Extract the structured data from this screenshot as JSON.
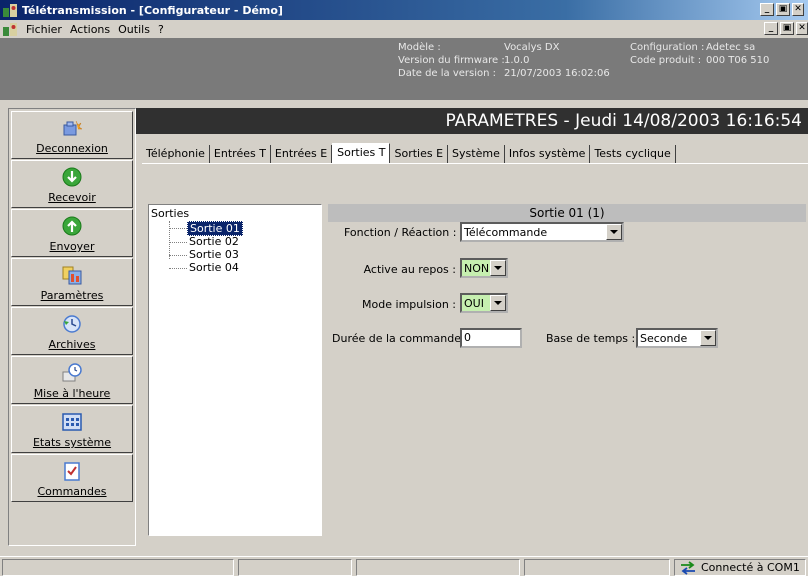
{
  "window": {
    "title": "Télétransmission - [Configurateur - Démo]",
    "controls": {
      "minimize": "_",
      "maximize": "🗗",
      "close": "✕"
    }
  },
  "menu": {
    "items": [
      "Fichier",
      "Actions",
      "Outils",
      "?"
    ]
  },
  "info": {
    "model_label": "Modèle :",
    "model_value": "Vocalys DX",
    "firmware_label": "Version du firmware :",
    "firmware_value": "1.0.0",
    "date_label": "Date de la version :",
    "date_value": "21/07/2003 16:02:06",
    "config_label": "Configuration :",
    "config_value": "Adetec sa",
    "product_label": "Code produit :",
    "product_value": "000 T06 510"
  },
  "sidebar": {
    "items": [
      {
        "label": "Deconnexion",
        "icon": "disconnect-icon",
        "accent": "#6a8fd8"
      },
      {
        "label": "Recevoir",
        "icon": "down-arrow-circle-icon",
        "accent": "#3aa63a"
      },
      {
        "label": "Envoyer",
        "icon": "up-arrow-circle-icon",
        "accent": "#3aa63a"
      },
      {
        "label": "Paramètres",
        "icon": "parameters-icon",
        "accent": "#e0a020"
      },
      {
        "label": "Archives",
        "icon": "archives-icon",
        "accent": "#4a7ad0"
      },
      {
        "label": "Mise à l'heure",
        "icon": "clock-icon",
        "accent": "#4a7ad0"
      },
      {
        "label": "Etats système",
        "icon": "grid-icon",
        "accent": "#2a5ab0"
      },
      {
        "label": "Commandes",
        "icon": "checklist-icon",
        "accent": "#4a7ad0"
      }
    ]
  },
  "header": {
    "title": "PARAMETRES - Jeudi 14/08/2003 16:16:54"
  },
  "tabs": [
    {
      "label": "Téléphonie"
    },
    {
      "label": "Entrées T"
    },
    {
      "label": "Entrées E"
    },
    {
      "label": "Sorties T",
      "active": true
    },
    {
      "label": "Sorties E"
    },
    {
      "label": "Système"
    },
    {
      "label": "Infos système"
    },
    {
      "label": "Tests cyclique"
    }
  ],
  "tree": {
    "root": "Sorties",
    "nodes": [
      "Sortie 01",
      "Sortie 02",
      "Sortie 03",
      "Sortie 04"
    ],
    "selected": "Sortie 01"
  },
  "panel": {
    "title": "Sortie 01 (1)",
    "fonction_label": "Fonction / Réaction :",
    "fonction_value": "Télécommande",
    "active_label": "Active au repos :",
    "active_value": "NON",
    "impulsion_label": "Mode impulsion :",
    "impulsion_value": "OUI",
    "duree_label": "Durée de la commande :",
    "duree_value": "0",
    "base_label": "Base de temps :",
    "base_value": "Seconde"
  },
  "status": {
    "connection": "Connecté à COM1",
    "connection_icon": "connection-arrows-icon"
  }
}
